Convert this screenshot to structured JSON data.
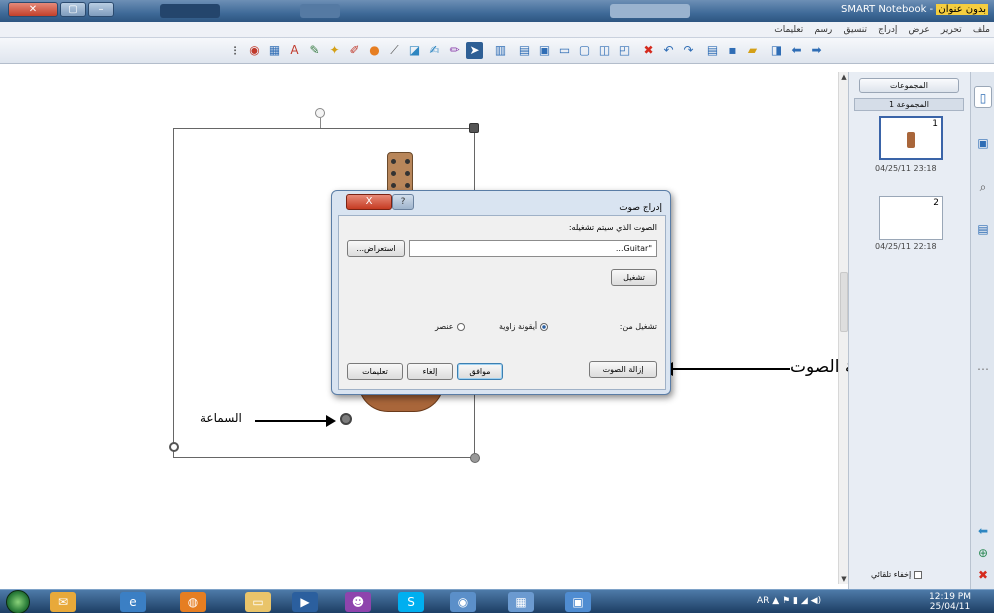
{
  "window": {
    "title_prefix": "بدون عنوان",
    "title_app": "SMART Notebook",
    "title_sep": " - "
  },
  "menu": {
    "items": [
      "ملف",
      "تحرير",
      "عرض",
      "إدراج",
      "تنسيق",
      "رسم",
      "تعليمات"
    ]
  },
  "toolbar": {
    "icons": [
      "select-arrow",
      "pen",
      "creative-pen",
      "eraser",
      "line",
      "shapes",
      "fill",
      "properties",
      "magic-pen",
      "shape-recognition",
      "text",
      "table",
      "delete",
      "undo",
      "redo",
      "screen-shade",
      "save",
      "open",
      "paste",
      "forward",
      "back"
    ]
  },
  "dialog": {
    "title": "إدراج صوت",
    "help_label": "?",
    "close_label": "X",
    "sound_label": "الصوت الذي سيتم تشغيله:",
    "file_value": "...Guitar",
    "file_prefix": "\"",
    "browse_label": "استعراض...",
    "play_label": "تشغيل",
    "play_from_label": "تشغيل من:",
    "option_corner": "أيقونة زاوية",
    "option_object": "عنصر",
    "remove_sound_label": "إزالة الصوت",
    "ok_label": "موافق",
    "cancel_label": "إلغاء",
    "help_btn_label": "تعليمات"
  },
  "annotations": {
    "speaker_label": "السماعة",
    "remove_sound_label": "إزالة الصوت"
  },
  "side_panel": {
    "groups_label": "المجموعات",
    "group1_label": "المجموعة 1",
    "pages": [
      {
        "number": "1",
        "date": "04/25/11 23:18"
      },
      {
        "number": "2",
        "date": "04/25/11 22:18"
      }
    ],
    "autohide_label": "إخفاء تلقائي"
  },
  "taskbar": {
    "lang": "AR",
    "time": "12:19 PM",
    "date": "25/04/11"
  },
  "colors": {
    "title_gradient_top": "#6d8fb5",
    "title_gradient_bottom": "#2d5580",
    "dialog_bg": "#d9e4f1",
    "taskbar_top": "#4d7aa8",
    "guitar": "#a9663a"
  }
}
